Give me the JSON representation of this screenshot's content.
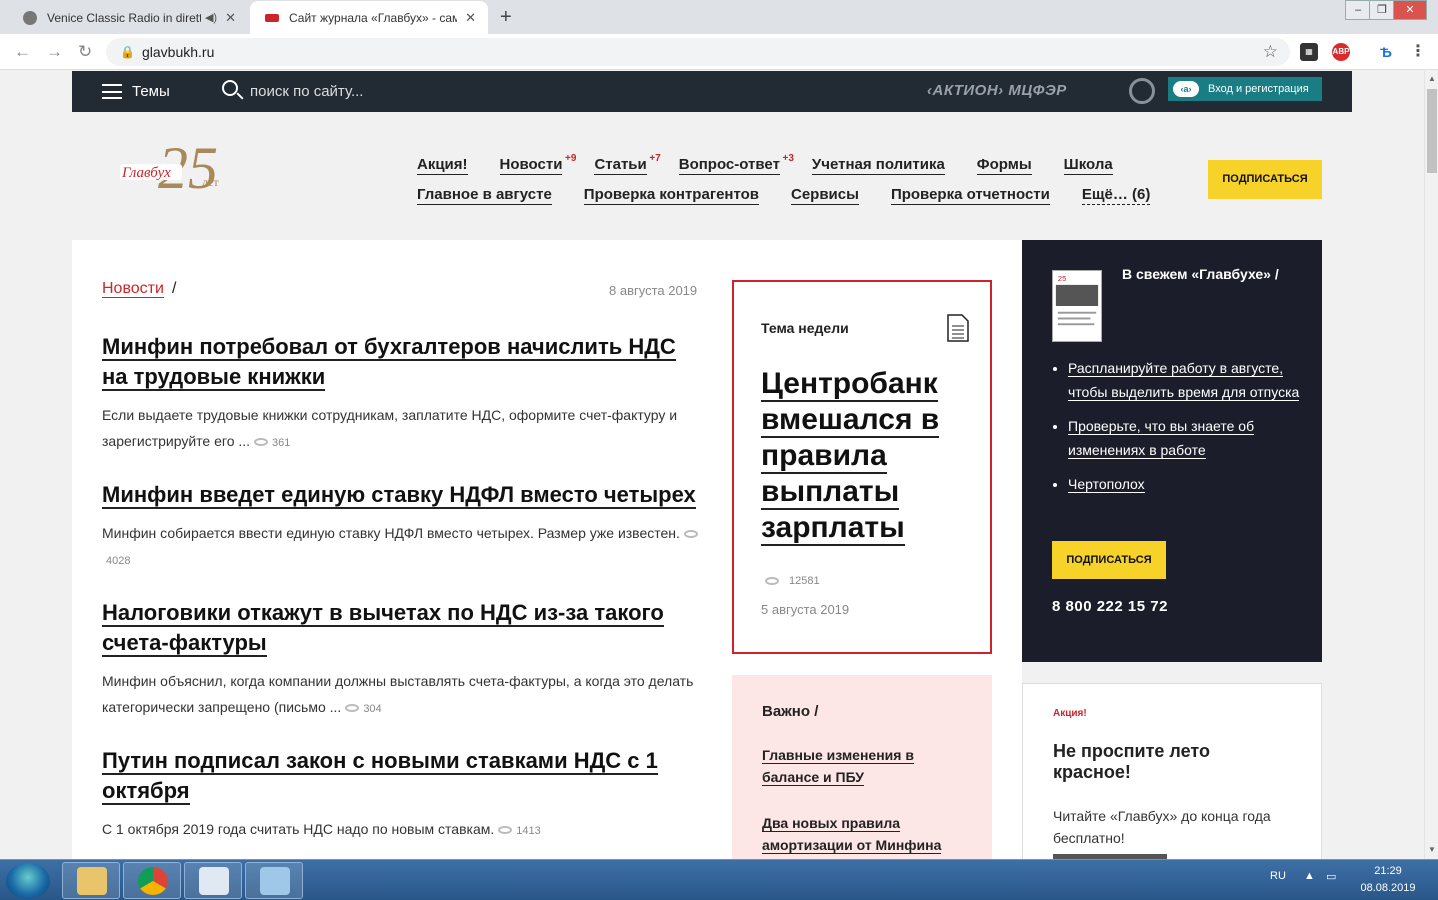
{
  "browser": {
    "tabs": [
      {
        "title": "Venice Classic Radio in diretta",
        "active": false
      },
      {
        "title": "Сайт журнала «Главбух» - самый",
        "active": true
      }
    ],
    "url": "glavbukh.ru"
  },
  "topbar": {
    "themes_label": "Темы",
    "search_placeholder": "поиск по сайту...",
    "brand": "‹АКТИОН› МЦФЭР",
    "login_label": "Вход и регистрация",
    "login_icon_text": "‹a›"
  },
  "header": {
    "logo_text": "25 лет Главбух",
    "menu_row1": [
      {
        "label": "Акция!",
        "badge": ""
      },
      {
        "label": "Новости",
        "badge": "+9"
      },
      {
        "label": "Статьи",
        "badge": "+7"
      },
      {
        "label": "Вопрос-ответ",
        "badge": "+3"
      },
      {
        "label": "Учетная политика",
        "badge": ""
      },
      {
        "label": "Формы",
        "badge": ""
      },
      {
        "label": "Школа",
        "badge": ""
      }
    ],
    "menu_row2": [
      {
        "label": "Главное в августе"
      },
      {
        "label": "Проверка контрагентов"
      },
      {
        "label": "Сервисы"
      },
      {
        "label": "Проверка отчетности"
      },
      {
        "label": "Ещё… (6)"
      }
    ],
    "subscribe_label": "ПОДПИСАТЬСЯ"
  },
  "news": {
    "section": "Новости",
    "separator": "/",
    "date": "8 августа 2019",
    "items": [
      {
        "title": "Минфин потребовал от бухгалтеров начислить НДС на трудовые книжки",
        "text": "Если выдаете трудовые книжки сотрудникам, заплатите НДС, оформите счет-фактуру и зарегистрируйте его ...",
        "views": "361"
      },
      {
        "title": "Минфин введет единую ставку НДФЛ вместо четырех",
        "text": "Минфин собирается ввести единую ставку НДФЛ вместо четырех. Размер уже известен.",
        "views": "4028"
      },
      {
        "title": "Налоговики откажут в вычетах по НДС из-за такого счета-фактуры",
        "text": "Минфин объяснил, когда компании должны выставлять счета-фактуры, а когда это делать категорически запрещено (письмо ...",
        "views": "304"
      },
      {
        "title": "Путин подписал закон с новыми ставками НДС с 1 октября",
        "text": "С 1 октября 2019 года считать НДС надо по новым ставкам.",
        "views": "1413"
      }
    ]
  },
  "topic": {
    "label": "Тема недели",
    "title": "Центробанк вмешался в правила выплаты зарплаты",
    "views": "12581",
    "date": "5 августа 2019"
  },
  "important": {
    "label": "Важно  /",
    "links": [
      "Главные изменения в балансе и ПБУ",
      "Два новых правила амортизации от Минфина"
    ]
  },
  "sidebar": {
    "title": "В свежем «Главбухе»   /",
    "links": [
      "Распланируйте работу в августе, чтобы выделить время для отпуска",
      "Проверьте, что вы знаете об изменениях в работе",
      "Чертополох"
    ],
    "subscribe_label": "ПОДПИСАТЬСЯ",
    "phone": "8 800 222 15 72"
  },
  "promo": {
    "tag": "Акция!",
    "title": "Не проспите лето красное!",
    "text": "Читайте «Главбух» до конца года бесплатно!"
  },
  "taskbar": {
    "lang": "RU",
    "time": "21:29",
    "date": "08.08.2019"
  },
  "colors": {
    "accent": "#cc2529",
    "yellow": "#f7d229",
    "dark": "#222a33",
    "sidebar": "#1b1e2a"
  }
}
